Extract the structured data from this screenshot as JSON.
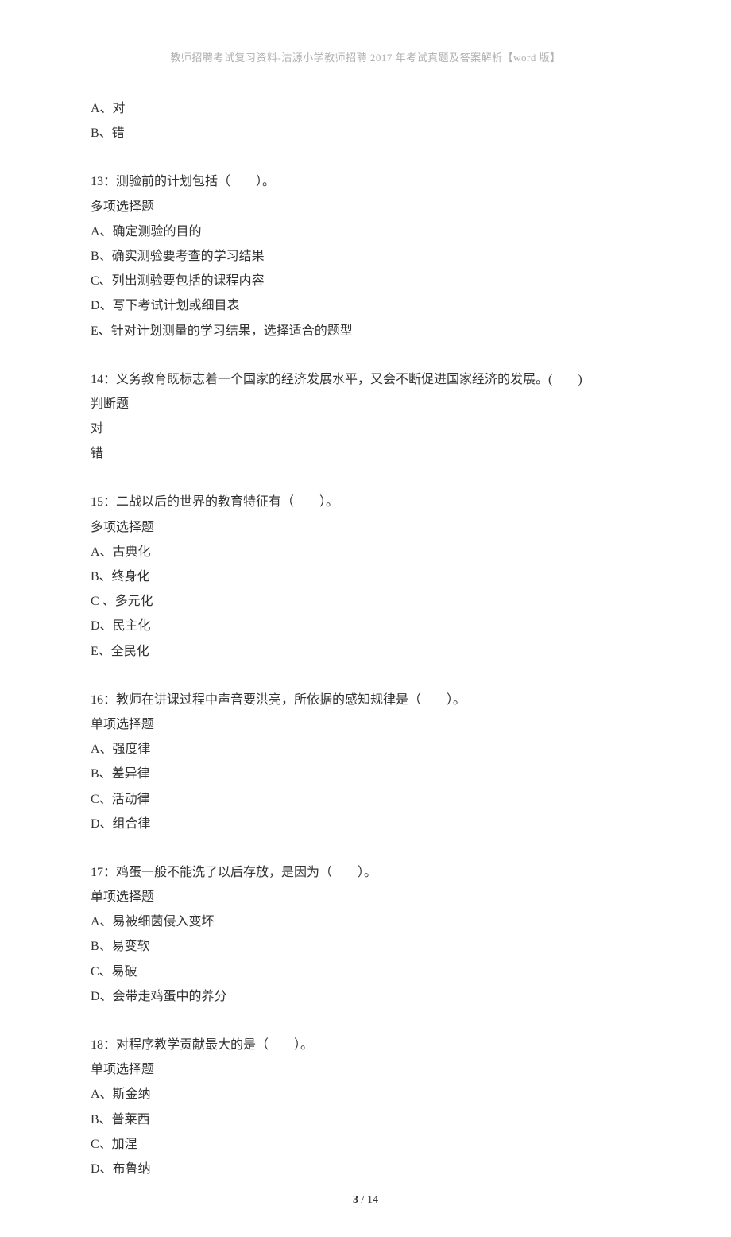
{
  "header": "教师招聘考试复习资料-沽源小学教师招聘 2017 年考试真题及答案解析【word 版】",
  "q12_tail": {
    "lines": [
      "A、对",
      "B、错"
    ]
  },
  "q13": {
    "title": "13：测验前的计划包括（　　）。",
    "type": "多项选择题",
    "options": [
      "A、确定测验的目的",
      "B、确实测验要考查的学习结果",
      "C、列出测验要包括的课程内容",
      "D、写下考试计划或细目表",
      "E、针对计划测量的学习结果，选择适合的题型"
    ]
  },
  "q14": {
    "title": "14：义务教育既标志着一个国家的经济发展水平，又会不断促进国家经济的发展。(　　)",
    "type": "判断题",
    "options": [
      "对",
      "错"
    ]
  },
  "q15": {
    "title": "15：二战以后的世界的教育特征有（　　）。",
    "type": "多项选择题",
    "options": [
      "A、古典化",
      "B、终身化",
      "C 、多元化",
      "D、民主化",
      "E、全民化"
    ]
  },
  "q16": {
    "title": "16：教师在讲课过程中声音要洪亮，所依据的感知规律是（　　）。",
    "type": "单项选择题",
    "options": [
      "A、强度律",
      "B、差异律",
      "C、活动律",
      "D、组合律"
    ]
  },
  "q17": {
    "title": "17：鸡蛋一般不能洗了以后存放，是因为（　　）。",
    "type": "单项选择题",
    "options": [
      "A、易被细菌侵入变坏",
      "B、易变软",
      "C、易破",
      "D、会带走鸡蛋中的养分"
    ]
  },
  "q18": {
    "title": "18：对程序教学贡献最大的是（　　）。",
    "type": "单项选择题",
    "options": [
      "A、斯金纳",
      "B、普莱西",
      "C、加涅",
      "D、布鲁纳"
    ]
  },
  "footer": {
    "current": "3",
    "sep": " / ",
    "total": "14"
  }
}
